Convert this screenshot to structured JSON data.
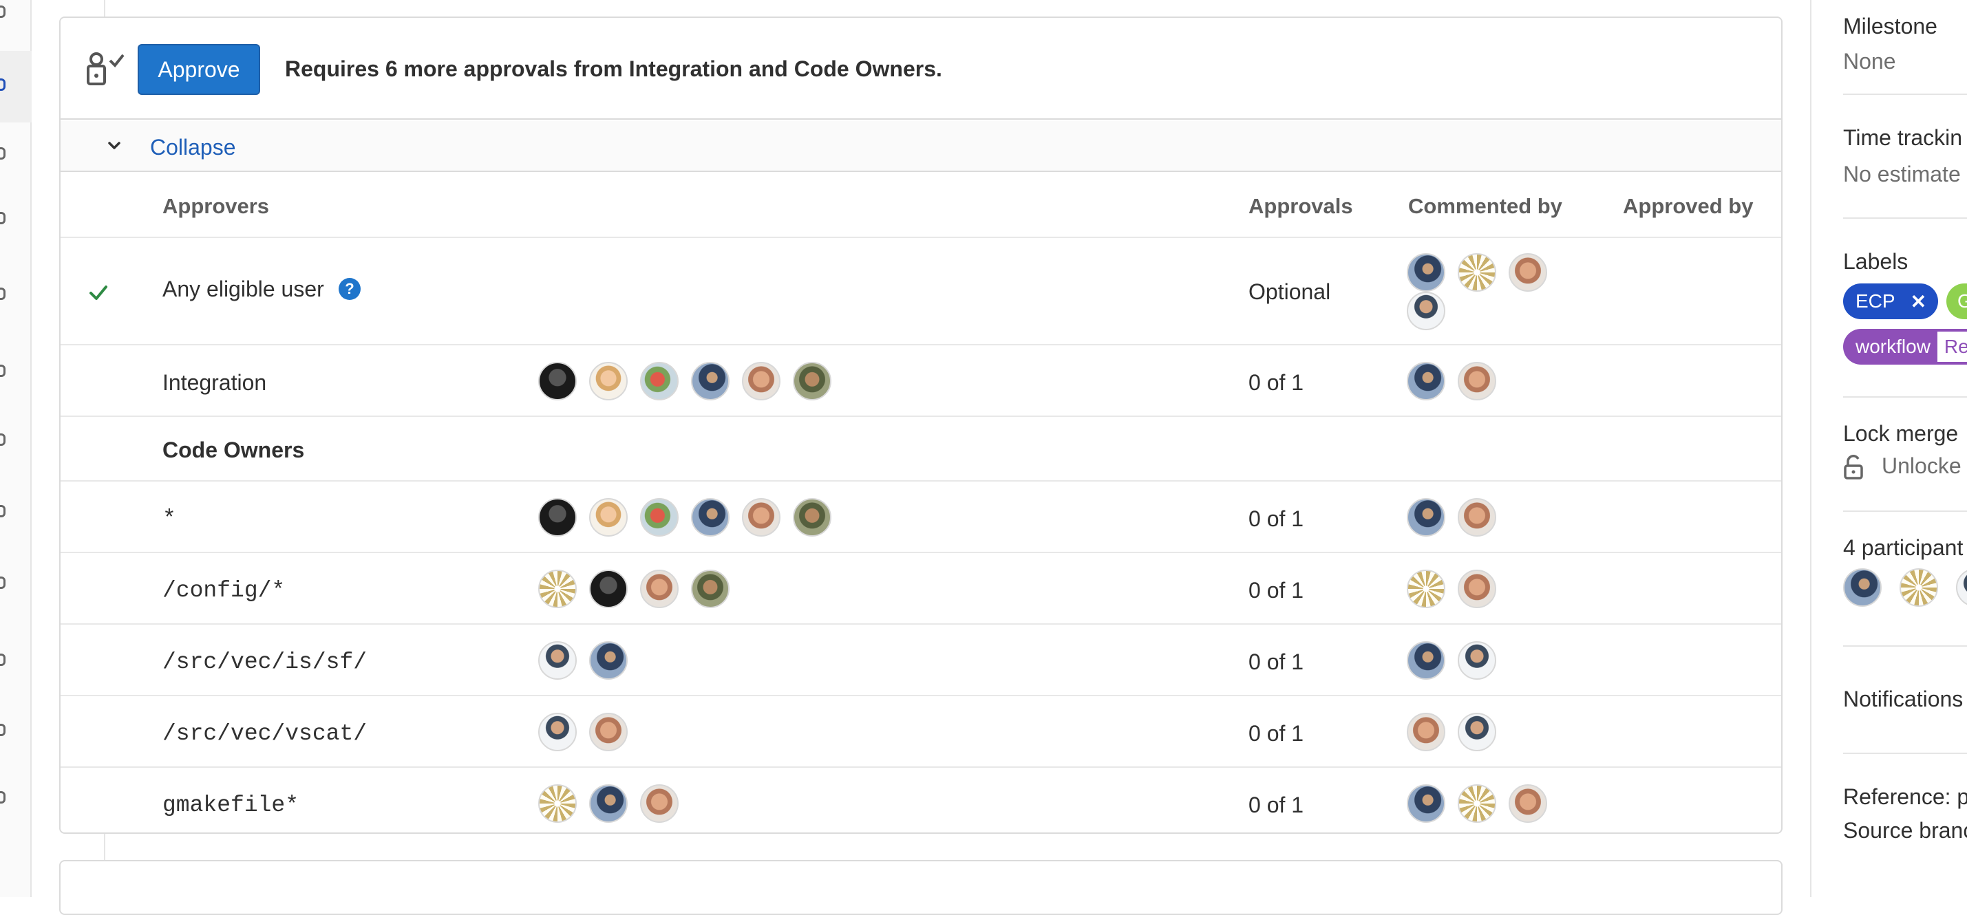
{
  "widget": {
    "approve_label": "Approve",
    "requires_text": "Requires 6 more approvals from Integration and Code Owners.",
    "collapse_label": "Collapse"
  },
  "table": {
    "headers": {
      "approvers": "Approvers",
      "approvals": "Approvals",
      "commented_by": "Commented by",
      "approved_by": "Approved by"
    },
    "rows": [
      {
        "name": "Any eligible user",
        "approvals": "Optional",
        "approved": true,
        "help": "?"
      },
      {
        "name": "Integration",
        "approvals": "0 of 1"
      },
      {
        "name": "Code Owners"
      },
      {
        "name": "*",
        "approvals": "0 of 1"
      },
      {
        "name": "/config/*",
        "approvals": "0 of 1"
      },
      {
        "name": "/src/vec/is/sf/",
        "approvals": "0 of 1"
      },
      {
        "name": "/src/vec/vscat/",
        "approvals": "0 of 1"
      },
      {
        "name": "gmakefile*",
        "approvals": "0 of 1"
      }
    ]
  },
  "sidebar": {
    "milestone_title": "Milestone",
    "milestone_value": "None",
    "time_tracking_title": "Time trackin",
    "time_tracking_value": "No estimate",
    "labels_title": "Labels",
    "labels": [
      {
        "text": "ECP",
        "close": "✕",
        "color": "#1f4fc4"
      },
      {
        "text": "G",
        "color": "#8fd14f"
      },
      {
        "text": "workflow",
        "suffix": "Re",
        "color": "#8e4fb8"
      }
    ],
    "lock_title": "Lock merge",
    "lock_value": "Unlocke",
    "participants_title": "4 participant",
    "notifications_title": "Notifications",
    "reference_text": "Reference: p",
    "source_branch_text": "Source branc"
  },
  "colors": {
    "primary": "#1f75cb",
    "link": "#1f5fb8",
    "success": "#2e8a43",
    "border": "#dbdbdb"
  }
}
